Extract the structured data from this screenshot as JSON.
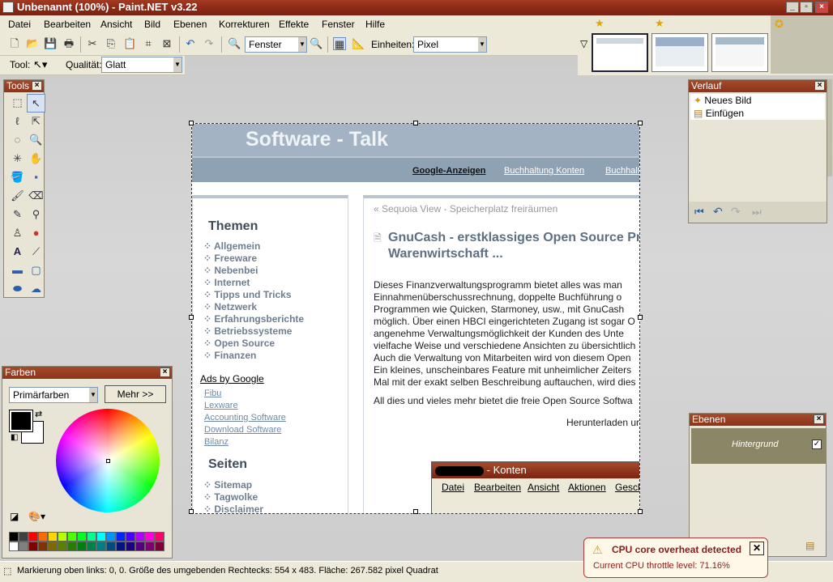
{
  "window": {
    "title": "Unbenannt (100%) - Paint.NET v3.22"
  },
  "menubar": [
    "Datei",
    "Bearbeiten",
    "Ansicht",
    "Bild",
    "Ebenen",
    "Korrekturen",
    "Effekte",
    "Fenster",
    "Hilfe"
  ],
  "toolbar": {
    "zoom_value": "Fenster",
    "units_label": "Einheiten:",
    "units_value": "Pixel",
    "tool_label": "Tool:",
    "quality_label": "Qualität:",
    "quality_value": "Glatt"
  },
  "tools_panel": {
    "title": "Tools"
  },
  "colors_panel": {
    "title": "Farben",
    "mode": "Primärfarben",
    "more_button": "Mehr >>",
    "palette": [
      "#000000",
      "#404040",
      "#ff0000",
      "#ff6a00",
      "#ffd800",
      "#b6ff00",
      "#4cff00",
      "#00ff21",
      "#00ff90",
      "#00ffff",
      "#0094ff",
      "#0026ff",
      "#4800ff",
      "#b200ff",
      "#ff00dc",
      "#ff006e",
      "#ffffff",
      "#808080",
      "#7f0000",
      "#7f3300",
      "#7f6a00",
      "#5b7f00",
      "#267f00",
      "#007f0e",
      "#007f46",
      "#007f7f",
      "#004a7f",
      "#00137f",
      "#21007f",
      "#57007f",
      "#7f006e",
      "#7f0037"
    ]
  },
  "history_panel": {
    "title": "Verlauf",
    "items": [
      "Neues Bild",
      "Einfügen"
    ]
  },
  "layers_panel": {
    "title": "Ebenen",
    "layer": "Hintergrund"
  },
  "canvas": {
    "logo": "Software - Talk",
    "nav": [
      "Google-Anzeigen",
      "Buchhaltung Konten",
      "Buchhalt"
    ],
    "themes_heading": "Themen",
    "themes": [
      "Allgemein",
      "Freeware",
      "Nebenbei",
      "Internet",
      "Tipps und Tricks",
      "Netzwerk",
      "Erfahrungsberichte",
      "Betriebssysteme",
      "Open Source",
      "Finanzen"
    ],
    "ads_heading": "Ads by Google",
    "ads": [
      "Fibu",
      "Lexware",
      "Accounting Software",
      "Download Software",
      "Bilanz"
    ],
    "pages_heading": "Seiten",
    "pages": [
      "Sitemap",
      "Tagwolke",
      "Disclaimer"
    ],
    "breadcrumb": "« Sequoia View - Speicherplatz freiräumen",
    "article_title_1": "GnuCash - erstklassiges Open Source Pr",
    "article_title_2": "Warenwirtschaft ...",
    "body": [
      "Dieses Finanzverwaltungsprogramm bietet alles was man",
      "Einnahmenüberschussrechnung, doppelte Buchführung o",
      "Programmen wie Quicken, Starmoney, usw., mit GnuCash",
      "möglich. Über einen HBCI eingerichteten Zugang ist sogar O",
      "angenehme Verwaltungsmöglichkeit der Kunden des Unte",
      "vielfache Weise und verschiedene Ansichten zu übersichtlich",
      "Auch die Verwaltung von Mitarbeiten wird von diesem Open",
      "Ein kleines, unscheinbares Feature mit unheimlicher Zeiters",
      "Mal mit der exakt selben Beschreibung auftauchen, wird dies"
    ],
    "summary": "All dies und vieles mehr bietet die freie Open Source Softwa",
    "download": "Herunterladen ur",
    "dialog_title": "- Konten",
    "dialog_menu": [
      "Datei",
      "Bearbeiten",
      "Ansicht",
      "Aktionen",
      "Gesch"
    ]
  },
  "status": "Markierung oben links: 0, 0. Größe des umgebenden Rechtecks: 554 x 483. Fläche: 267.582 pixel Quadrat",
  "toast": {
    "title": "CPU core overheat detected",
    "message": "Current CPU throttle level: 71.16%"
  }
}
